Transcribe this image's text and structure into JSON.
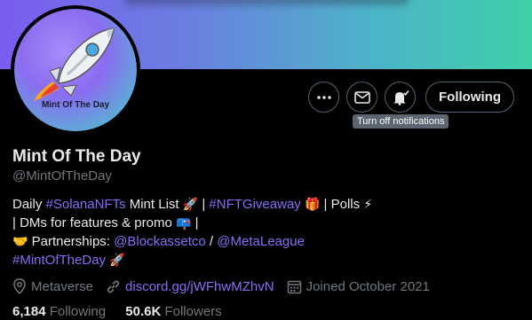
{
  "profile": {
    "display_name": "Mint Of The Day",
    "handle": "@MintOfTheDay",
    "avatar_text": "Mint Of The Day"
  },
  "actions": {
    "following_label": "Following",
    "notify_tooltip": "Turn off notifications"
  },
  "bio": {
    "line1_a": "Daily ",
    "line1_tag1": "#SolanaNFTs",
    "line1_b": " Mint List ",
    "line1_rocket": "🚀",
    "line1_c": " | ",
    "line1_tag2": "#NFTGiveaway",
    "line1_gift": "🎁",
    "line1_d": " | Polls ",
    "line1_bolt": "⚡",
    "line2_a": "| DMs for features & promo ",
    "line2_mailbox": "📪",
    "line2_b": " |",
    "line3_handshake": "🤝",
    "line3_a": " Partnerships: ",
    "line3_link1": "@Blockassetco",
    "line3_b": " / ",
    "line3_link2": "@MetaLeague",
    "line4_tag": "#MintOfTheDay",
    "line4_rocket": "🚀"
  },
  "meta": {
    "location": "Metaverse",
    "website": "discord.gg/jWFhwMZhvN",
    "joined": "Joined October 2021"
  },
  "stats": {
    "following_count": "6,184",
    "following_label": "Following",
    "followers_count": "50.6K",
    "followers_label": "Followers"
  },
  "colors": {
    "accent": "#8b6cf6",
    "muted": "#71767b",
    "text": "#e7e9ea",
    "background": "#000000"
  },
  "icons": {
    "more": "more-dots-icon",
    "message": "envelope-icon",
    "notify": "bell-check-icon",
    "location": "location-pin-icon",
    "website": "link-icon",
    "joined": "calendar-icon"
  }
}
